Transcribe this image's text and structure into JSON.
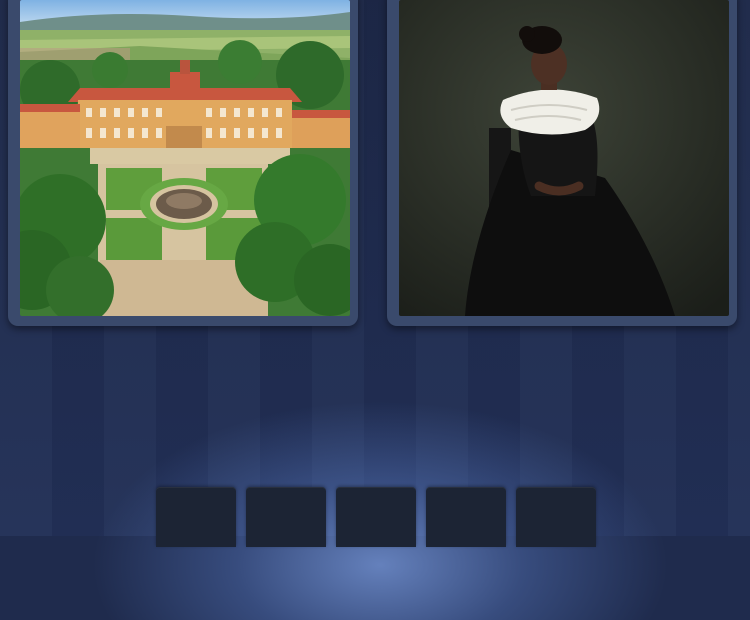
{
  "pictures": [
    {
      "subject": "baroque-chateau-with-garden"
    },
    {
      "subject": "woman-in-black-dress-with-ruff-collar"
    }
  ],
  "answer_slots": [
    {
      "letter": ""
    },
    {
      "letter": ""
    },
    {
      "letter": ""
    },
    {
      "letter": ""
    },
    {
      "letter": ""
    }
  ],
  "colors": {
    "background": "#1f2b4d",
    "card_frame": "#3a4a6c",
    "slot": "#1c2434",
    "glow": "#8aa5eb"
  }
}
